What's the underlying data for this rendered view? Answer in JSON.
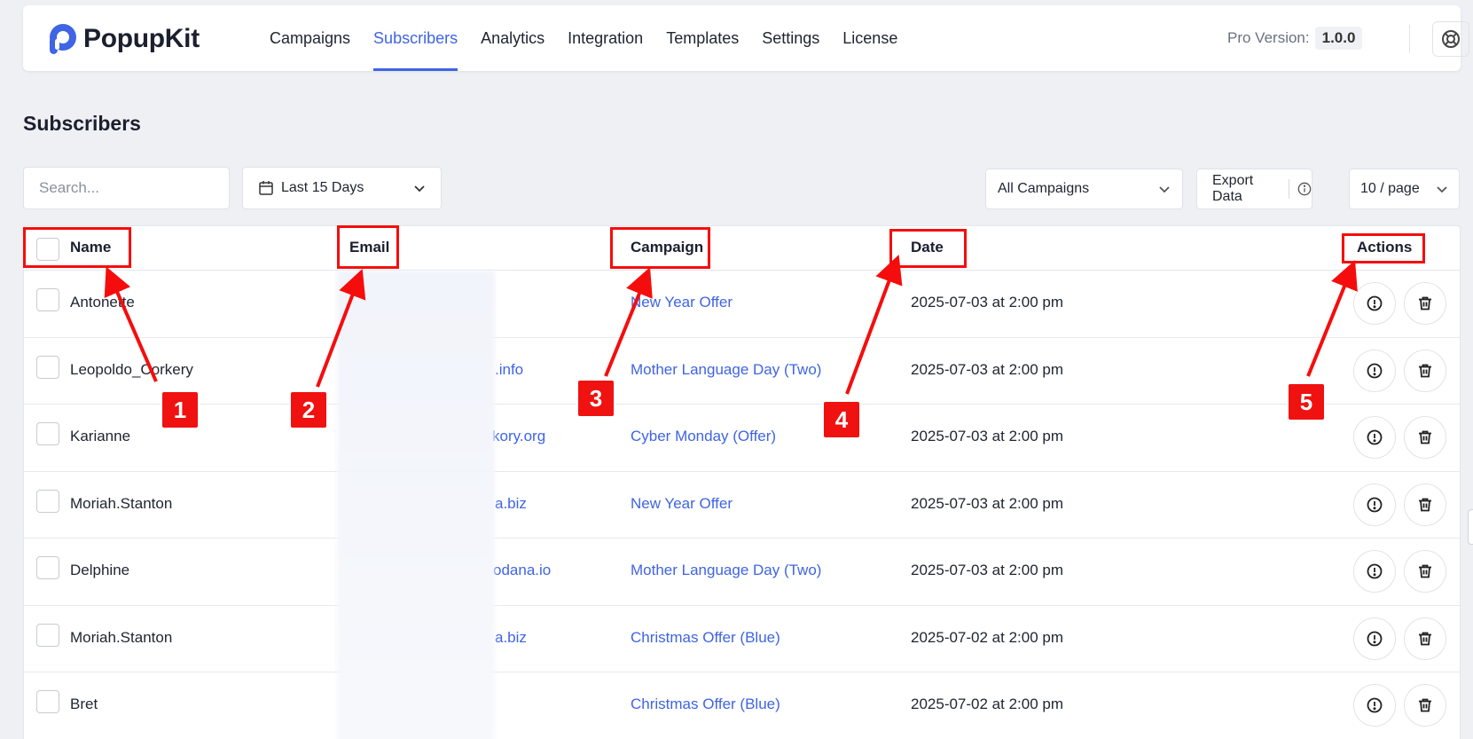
{
  "brand": {
    "name": "PopupKit",
    "accent": "#3f64e4"
  },
  "nav": {
    "items": [
      {
        "label": "Campaigns",
        "active": false
      },
      {
        "label": "Subscribers",
        "active": true
      },
      {
        "label": "Analytics",
        "active": false
      },
      {
        "label": "Integration",
        "active": false
      },
      {
        "label": "Templates",
        "active": false
      },
      {
        "label": "Settings",
        "active": false
      },
      {
        "label": "License",
        "active": false
      }
    ],
    "pro_label": "Pro Version:",
    "pro_version": "1.0.0",
    "help_icon": "lifebuoy-icon"
  },
  "page": {
    "title": "Subscribers"
  },
  "filters": {
    "search_placeholder": "Search...",
    "date_range": "Last 15 Days",
    "campaign": "All Campaigns",
    "export_label": "Export Data",
    "per_page": "10 / page"
  },
  "table": {
    "columns": {
      "name": "Name",
      "email": "Email",
      "campaign": "Campaign",
      "date": "Date",
      "actions": "Actions"
    },
    "rows": [
      {
        "name": "Antonette",
        "email_visible": "",
        "campaign": "New Year Offer",
        "date": "2025-07-03 at 2:00 pm"
      },
      {
        "name": "Leopoldo_Corkery",
        "email_visible": ".info",
        "campaign": "Mother Language Day (Two)",
        "date": "2025-07-03 at 2:00 pm"
      },
      {
        "name": "Karianne",
        "email_visible": "kory.org",
        "campaign": "Cyber Monday (Offer)",
        "date": "2025-07-03 at 2:00 pm"
      },
      {
        "name": "Moriah.Stanton",
        "email_visible": "a.biz",
        "campaign": "New Year Offer",
        "date": "2025-07-03 at 2:00 pm"
      },
      {
        "name": "Delphine",
        "email_visible": "odana.io",
        "campaign": "Mother Language Day (Two)",
        "date": "2025-07-03 at 2:00 pm"
      },
      {
        "name": "Moriah.Stanton",
        "email_visible": "a.biz",
        "campaign": "Christmas Offer (Blue)",
        "date": "2025-07-02 at 2:00 pm"
      },
      {
        "name": "Bret",
        "email_visible": "",
        "campaign": "Christmas Offer (Blue)",
        "date": "2025-07-02 at 2:00 pm"
      }
    ]
  },
  "annotations": {
    "badges": [
      "1",
      "2",
      "3",
      "4",
      "5"
    ],
    "color": "#f50d0d"
  }
}
